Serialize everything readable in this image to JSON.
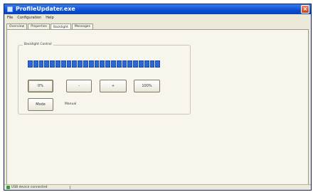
{
  "window": {
    "title": "ProfileUpdater.exe"
  },
  "menu": [
    "File",
    "Configuration",
    "Help"
  ],
  "tabs": [
    "Overview",
    "Properties",
    "Backlight",
    "Messages"
  ],
  "active_tab": "Backlight",
  "backlight": {
    "group_label": "Backlight Control",
    "level": {
      "segments": 24,
      "filled": 24
    },
    "buttons": {
      "min": "0%",
      "minus": "-",
      "plus": "+",
      "max": "100%",
      "mode": "Mode"
    },
    "mode_value": "Manual"
  },
  "status": {
    "text": "USB device connected"
  },
  "colors": {
    "titlebar": "#0a4fd4",
    "level_fill": "#2b68d8",
    "window_bg": "#ece9d8"
  }
}
